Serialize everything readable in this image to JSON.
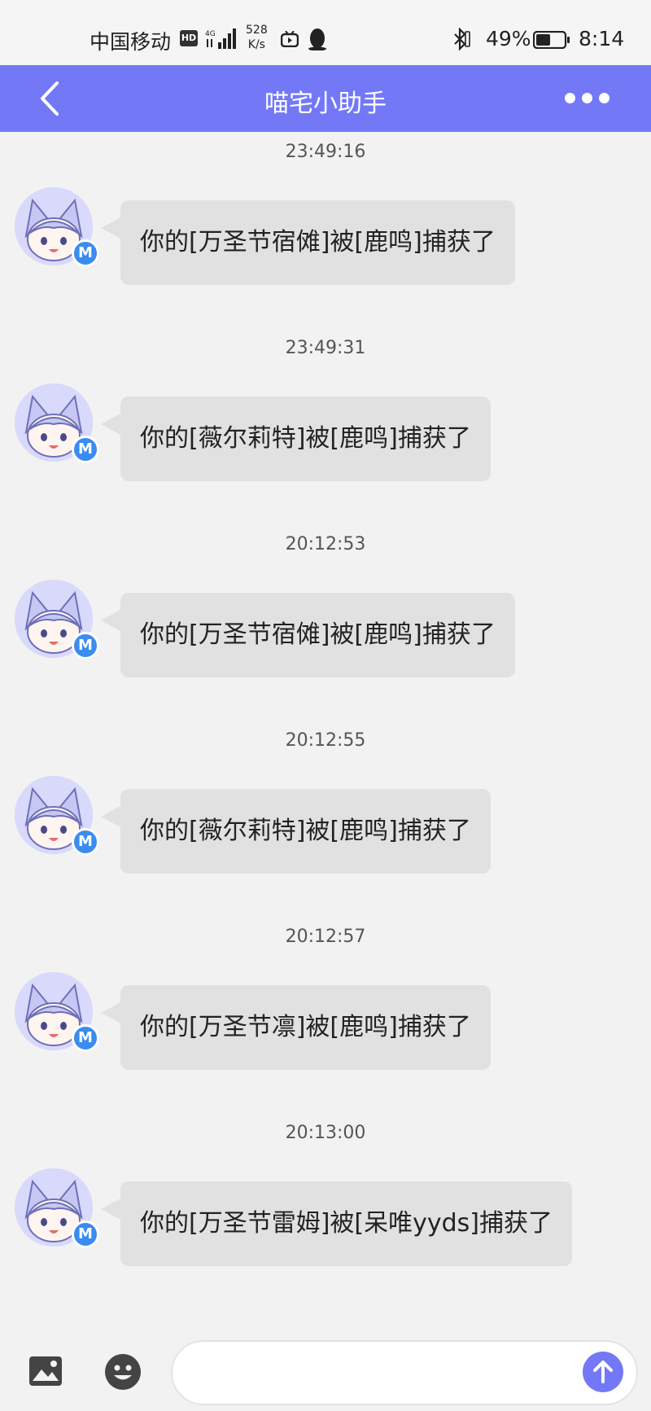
{
  "status_bar": {
    "carrier": "中国移动",
    "hd_badge": "HD",
    "net_speed_value": "528",
    "net_speed_unit": "K/s",
    "battery_percent": "49%",
    "time": "8:14"
  },
  "header": {
    "title": "喵宅小助手"
  },
  "messages": [
    {
      "time": "23:49:16",
      "text": "你的[万圣节宿傩]被[鹿鸣]捕获了"
    },
    {
      "time": "23:49:31",
      "text": "你的[薇尔莉特]被[鹿鸣]捕获了"
    },
    {
      "time": "20:12:53",
      "text": "你的[万圣节宿傩]被[鹿鸣]捕获了"
    },
    {
      "time": "20:12:55",
      "text": "你的[薇尔莉特]被[鹿鸣]捕获了"
    },
    {
      "time": "20:12:57",
      "text": "你的[万圣节凛]被[鹿鸣]捕获了"
    },
    {
      "time": "20:13:00",
      "text": "你的[万圣节雷姆]被[呆唯yyds]捕获了"
    }
  ],
  "avatar_badge": "M",
  "input": {
    "value": "",
    "placeholder": ""
  },
  "colors": {
    "accent": "#7378f7",
    "bubble": "#e1e1e1",
    "badge": "#3a8cf0"
  }
}
